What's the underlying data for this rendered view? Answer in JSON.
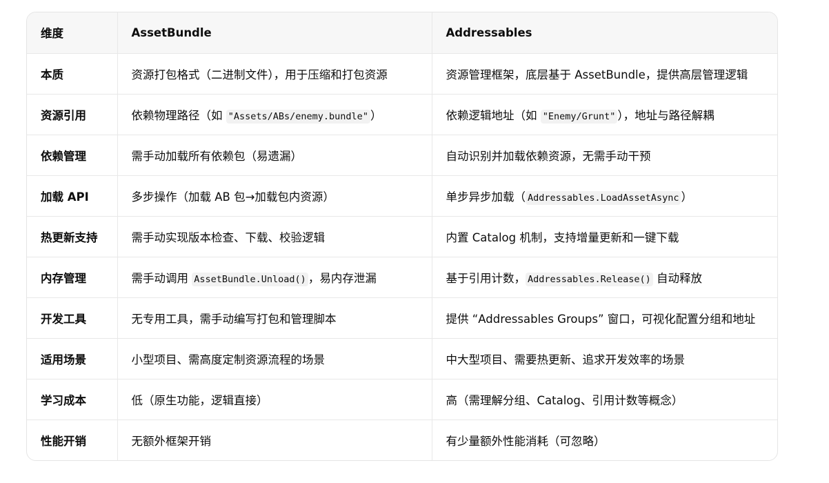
{
  "table": {
    "headers": [
      "维度",
      "AssetBundle",
      "Addressables"
    ],
    "rows": [
      {
        "dim": "本质",
        "ab": [
          {
            "t": "资源打包格式（二进制文件），用于压缩和打包资源"
          }
        ],
        "addr": [
          {
            "t": "资源管理框架，底层基于 AssetBundle，提供高层管理逻辑"
          }
        ]
      },
      {
        "dim": "资源引用",
        "ab": [
          {
            "t": "依赖物理路径（如 "
          },
          {
            "c": "\"Assets/ABs/enemy.bundle\""
          },
          {
            "t": "）"
          }
        ],
        "addr": [
          {
            "t": "依赖逻辑地址（如 "
          },
          {
            "c": "\"Enemy/Grunt\""
          },
          {
            "t": "），地址与路径解耦"
          }
        ]
      },
      {
        "dim": "依赖管理",
        "ab": [
          {
            "t": "需手动加载所有依赖包（易遗漏）"
          }
        ],
        "addr": [
          {
            "t": "自动识别并加载依赖资源，无需手动干预"
          }
        ]
      },
      {
        "dim": "加载 API",
        "ab": [
          {
            "t": "多步操作（加载 AB 包→加载包内资源）"
          }
        ],
        "addr": [
          {
            "t": "单步异步加载（"
          },
          {
            "c": "Addressables.LoadAssetAsync"
          },
          {
            "t": "）"
          }
        ]
      },
      {
        "dim": "热更新支持",
        "ab": [
          {
            "t": "需手动实现版本检查、下载、校验逻辑"
          }
        ],
        "addr": [
          {
            "t": "内置 Catalog 机制，支持增量更新和一键下载"
          }
        ]
      },
      {
        "dim": "内存管理",
        "ab": [
          {
            "t": "需手动调用 "
          },
          {
            "c": "AssetBundle.Unload()"
          },
          {
            "t": "，易内存泄漏"
          }
        ],
        "addr": [
          {
            "t": "基于引用计数，"
          },
          {
            "c": "Addressables.Release()"
          },
          {
            "t": " 自动释放"
          }
        ]
      },
      {
        "dim": "开发工具",
        "ab": [
          {
            "t": "无专用工具，需手动编写打包和管理脚本"
          }
        ],
        "addr": [
          {
            "t": "提供 “Addressables Groups” 窗口，可视化配置分组和地址"
          }
        ]
      },
      {
        "dim": "适用场景",
        "ab": [
          {
            "t": "小型项目、需高度定制资源流程的场景"
          }
        ],
        "addr": [
          {
            "t": "中大型项目、需要热更新、追求开发效率的场景"
          }
        ]
      },
      {
        "dim": "学习成本",
        "ab": [
          {
            "t": "低（原生功能，逻辑直接）"
          }
        ],
        "addr": [
          {
            "t": "高（需理解分组、Catalog、引用计数等概念）"
          }
        ]
      },
      {
        "dim": "性能开销",
        "ab": [
          {
            "t": "无额外框架开销"
          }
        ],
        "addr": [
          {
            "t": "有少量额外性能消耗（可忽略）"
          }
        ]
      }
    ]
  }
}
